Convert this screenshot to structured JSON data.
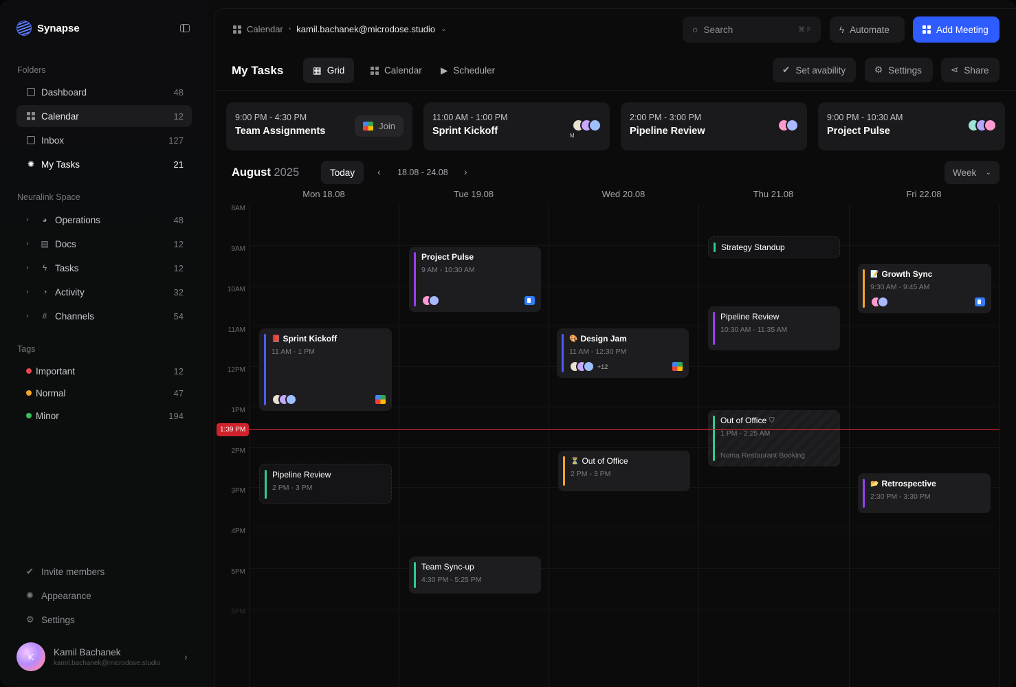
{
  "app": {
    "name": "Synapse"
  },
  "sidebar": {
    "folders_label": "Folders",
    "folders": [
      {
        "label": "Dashboard",
        "count": "48",
        "icon": "dashboard-icon"
      },
      {
        "label": "Calendar",
        "count": "12",
        "icon": "calendar-grid-icon"
      },
      {
        "label": "Inbox",
        "count": "127",
        "icon": "inbox-icon"
      },
      {
        "label": "My Tasks",
        "count": "21",
        "icon": "sun-icon"
      }
    ],
    "space_label": "Neuralink Space",
    "space": [
      {
        "label": "Operations",
        "count": "48",
        "icon": "pie-chart-icon"
      },
      {
        "label": "Docs",
        "count": "12",
        "icon": "docs-icon"
      },
      {
        "label": "Tasks",
        "count": "12",
        "icon": "bolt-icon"
      },
      {
        "label": "Activity",
        "count": "32",
        "icon": "activity-icon"
      },
      {
        "label": "Channels",
        "count": "54",
        "icon": "hash-icon"
      }
    ],
    "tags_label": "Tags",
    "tags": [
      {
        "label": "Important",
        "count": "12",
        "color": "#e5484d"
      },
      {
        "label": "Normal",
        "count": "47",
        "color": "#f5a524"
      },
      {
        "label": "Minor",
        "count": "194",
        "color": "#3dbb5c"
      }
    ],
    "footer": [
      {
        "label": "Invite members",
        "icon": "check-circle-icon"
      },
      {
        "label": "Appearance",
        "icon": "sun-icon"
      },
      {
        "label": "Settings",
        "icon": "gear-icon"
      }
    ],
    "profile": {
      "initial": "K",
      "name": "Kamil Bachanek",
      "email": "kamil.bachanek@microdose.studio"
    }
  },
  "topbar": {
    "crumb_app": "Calendar",
    "crumb_email": "kamil.bachanek@microdose.studio",
    "search_placeholder": "Search",
    "search_kbd": "⌘ F",
    "automate": "Automate",
    "add_meeting": "Add Meeting"
  },
  "view": {
    "title": "My Tasks",
    "tabs": [
      "Grid",
      "Calendar",
      "Scheduler"
    ],
    "actions": [
      "Set avability",
      "Settings",
      "Share"
    ]
  },
  "upcoming": [
    {
      "time": "9:00 PM - 4:30 PM",
      "title": "Team Assignments",
      "join": "Join"
    },
    {
      "time": "11:00 AM - 1:00 PM",
      "title": "Sprint Kickoff",
      "avatar_note": "M"
    },
    {
      "time": "2:00 PM - 3:00 PM",
      "title": "Pipeline Review"
    },
    {
      "time": "9:00 PM - 10:30 AM",
      "title": "Project Pulse"
    }
  ],
  "calendar": {
    "month": "August",
    "year": "2025",
    "today": "Today",
    "range": "18.08 - 24.08",
    "view_mode": "Week",
    "days": [
      "Mon 18.08",
      "Tue 19.08",
      "Wed 20.08",
      "Thu 21.08",
      "Fri 22.08"
    ],
    "hours": [
      "8AM",
      "9AM",
      "10AM",
      "11AM",
      "12PM",
      "1PM",
      "2PM",
      "3PM",
      "4PM",
      "5PM",
      "6PM"
    ],
    "now": "1:39 PM",
    "events": [
      {
        "title": "Project Pulse",
        "time": "9 AM - 10:30 AM",
        "color": "#9b3df5"
      },
      {
        "title": "Strategy Standup",
        "color": "#2ecc8f"
      },
      {
        "title": "Growth Sync",
        "time": "9:30 AM - 9:45 AM",
        "color": "#f5a524",
        "emoji": "📝"
      },
      {
        "title": "Pipeline Review",
        "time": "10:30 AM - 11:35 AM",
        "color": "#9b3df5"
      },
      {
        "title": "Sprint Kickoff",
        "time": "11 AM - 1 PM",
        "color": "#4b5cf5",
        "emoji": "📕"
      },
      {
        "title": "Design Jam",
        "time": "11 AM - 12:30 PM",
        "color": "#4b5cf5",
        "emoji": "🎨",
        "more": "+12"
      },
      {
        "title": "Out of Office",
        "time": "1 PM - 2:25 AM",
        "color": "#2ecc8f",
        "note": "Noma Restaurant Booking"
      },
      {
        "title": "Out of Office",
        "time": "2 PM - 3 PM",
        "color": "#f5a524",
        "emoji": "⏳"
      },
      {
        "title": "Pipeline Review",
        "time": "2 PM - 3 PM",
        "color": "#2ecc8f"
      },
      {
        "title": "Retrospective",
        "time": "2:30 PM - 3:30 PM",
        "color": "#9b3df5",
        "emoji": "📂"
      },
      {
        "title": "Team Sync-up",
        "time": "4:30 PM - 5:25 PM",
        "color": "#2ecc8f"
      }
    ]
  }
}
